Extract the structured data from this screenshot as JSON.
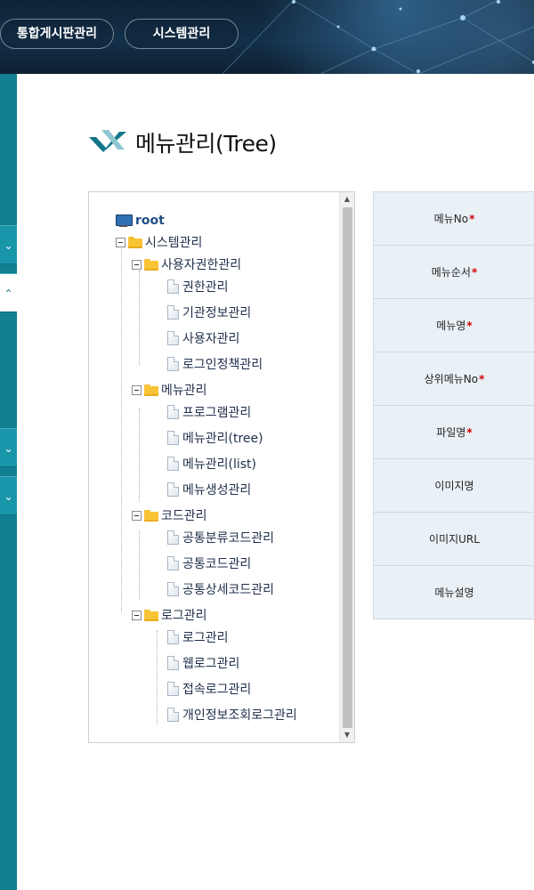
{
  "header": {
    "tabs": [
      {
        "label": "통합게시판관리"
      },
      {
        "label": "시스템관리"
      }
    ]
  },
  "sidebar": {
    "buttons": [
      {
        "icon": "chevron-down-icon",
        "glyph": "⌄"
      },
      {
        "icon": "chevron-up-icon",
        "glyph": "⌃",
        "active": true
      },
      {
        "icon": "chevron-down-icon",
        "glyph": "⌄"
      },
      {
        "icon": "chevron-down-icon",
        "glyph": "⌄"
      }
    ]
  },
  "page": {
    "title": "메뉴관리(Tree)"
  },
  "tree": {
    "root": "root",
    "system": "시스템관리",
    "groups": [
      {
        "label": "사용자권한관리",
        "items": [
          "권한관리",
          "기관정보관리",
          "사용자관리",
          "로그인정책관리"
        ]
      },
      {
        "label": "메뉴관리",
        "items": [
          "프로그램관리",
          "메뉴관리(tree)",
          "메뉴관리(list)",
          "메뉴생성관리"
        ]
      },
      {
        "label": "코드관리",
        "items": [
          "공통분류코드관리",
          "공통코드관리",
          "공통상세코드관리"
        ]
      },
      {
        "label": "로그관리",
        "items": [
          "로그관리",
          "웹로그관리",
          "접속로그관리",
          "개인정보조회로그관리"
        ]
      }
    ]
  },
  "form": {
    "fields": [
      {
        "label": "메뉴No",
        "required": true
      },
      {
        "label": "메뉴순서",
        "required": true
      },
      {
        "label": "메뉴명",
        "required": true
      },
      {
        "label": "상위메뉴No",
        "required": true
      },
      {
        "label": "파일명",
        "required": true
      },
      {
        "label": "이미지명",
        "required": false
      },
      {
        "label": "이미지URL",
        "required": false
      },
      {
        "label": "메뉴설명",
        "required": false
      }
    ],
    "required_mark": "*"
  },
  "colors": {
    "accent": "#137f92",
    "required": "#d00000",
    "form_bg": "#e9f0f6"
  }
}
